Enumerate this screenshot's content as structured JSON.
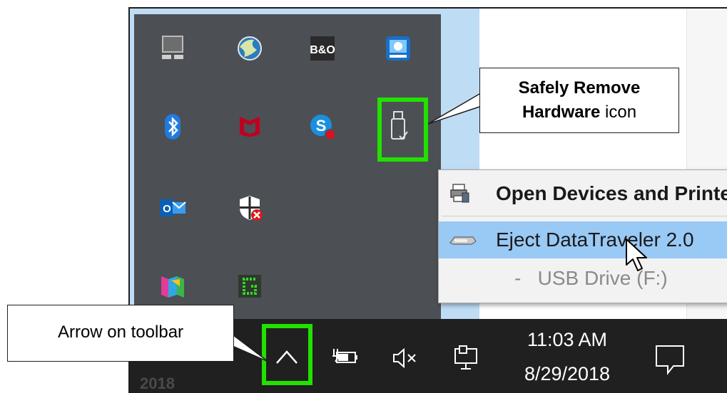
{
  "callouts": {
    "safely_remove_bold": "Safely Remove",
    "safely_remove_line2_bold": "Hardware",
    "safely_remove_line2_rest": " icon",
    "arrow_toolbar": "Arrow on toolbar"
  },
  "context_menu": {
    "open_devices": "Open Devices and Printers",
    "eject": "Eject DataTraveler 2.0",
    "usb_drive": "-   USB Drive (F:)"
  },
  "taskbar": {
    "time": "11:03 AM",
    "date": "8/29/2018",
    "corner_text": "2018"
  },
  "tray_icons": [
    "monitor-icon",
    "globe-icon",
    "bo-icon",
    "intel-graphics-icon",
    "bluetooth-icon",
    "mcafee-icon",
    "skype-icon",
    "usb-drive-icon",
    "outlook-icon",
    "security-shield-icon",
    "maps-icon",
    "green-g-icon"
  ],
  "tray_labels": {
    "bo": "B&O",
    "outlook": "O"
  },
  "colors": {
    "highlight_green": "#22e000",
    "menu_selected": "#99c9f5",
    "taskbar": "#202020",
    "tray_panel": "#4c4f54"
  }
}
